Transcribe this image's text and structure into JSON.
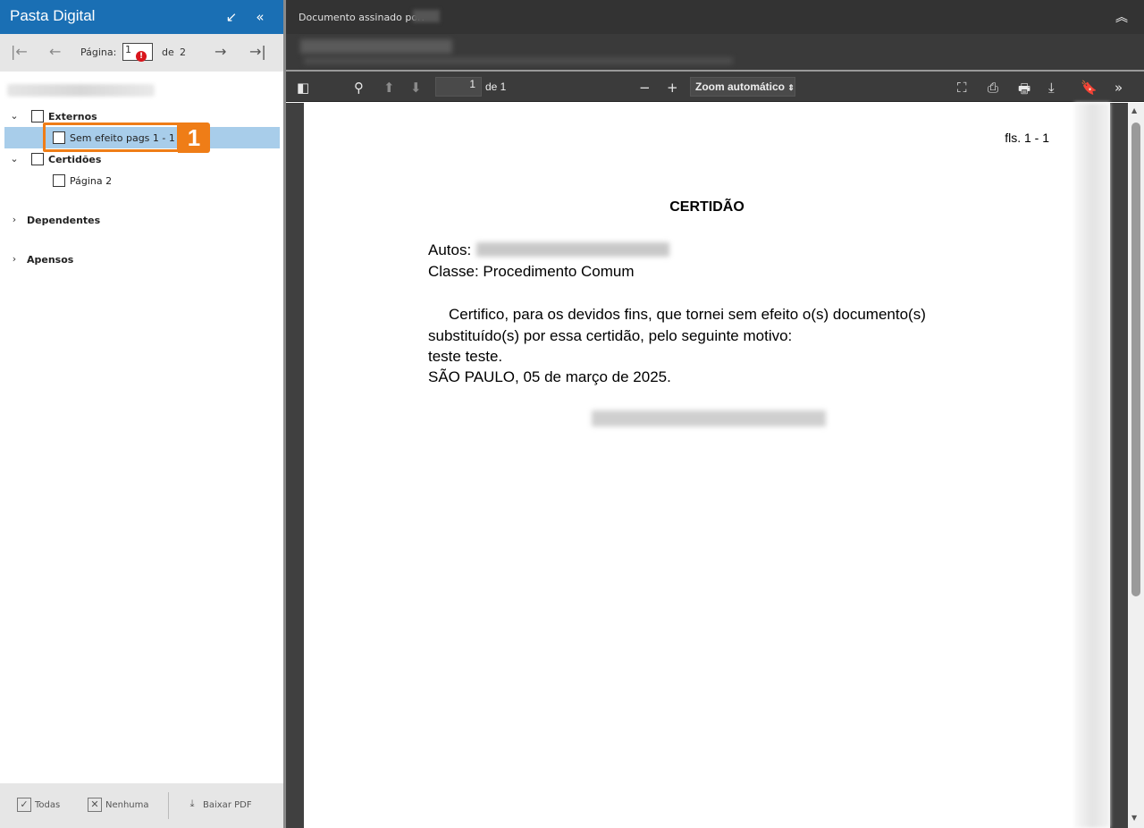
{
  "left_panel": {
    "title": "Pasta Digital",
    "collapse_icon": "↙",
    "hide_icon": "«",
    "pager": {
      "first_icon": "|←",
      "prev_icon": "←",
      "label": "Página:",
      "current": "1",
      "of": "de",
      "total": "2",
      "next_icon": "→",
      "last_icon": "→|"
    },
    "tree": {
      "externos": "Externos",
      "sem_efeito": "Sem efeito pags 1 - 1",
      "certidoes": "Certidões",
      "pagina2": "Página 2",
      "dependentes": "Dependentes",
      "apensos": "Apensos"
    },
    "callout_number": "1",
    "footer": {
      "all": "Todas",
      "none": "Nenhuma",
      "download": "Baixar PDF"
    }
  },
  "signature_bar": {
    "text": "Documento assinado por:"
  },
  "pdf_toolbar": {
    "page_input": "1",
    "of_pages": "de 1",
    "zoom": "Zoom automático"
  },
  "document": {
    "fls": "fls. 1 - 1",
    "title": "CERTIDÃO",
    "autos_label": "Autos:",
    "classe": "Classe: Procedimento Comum",
    "body_line1": "Certifico, para os devidos fins, que tornei sem efeito o(s) documento(s)",
    "body_line2": "substituído(s) por essa certidão, pelo seguinte motivo:",
    "motivo": "teste teste.",
    "local_data": "SÃO PAULO, 05 de março de 2025."
  },
  "colors": {
    "header_blue": "#1a6fb4",
    "selected_row": "#a8cdea",
    "callout_orange": "#ef7d17",
    "viewer_dark": "#404040"
  }
}
